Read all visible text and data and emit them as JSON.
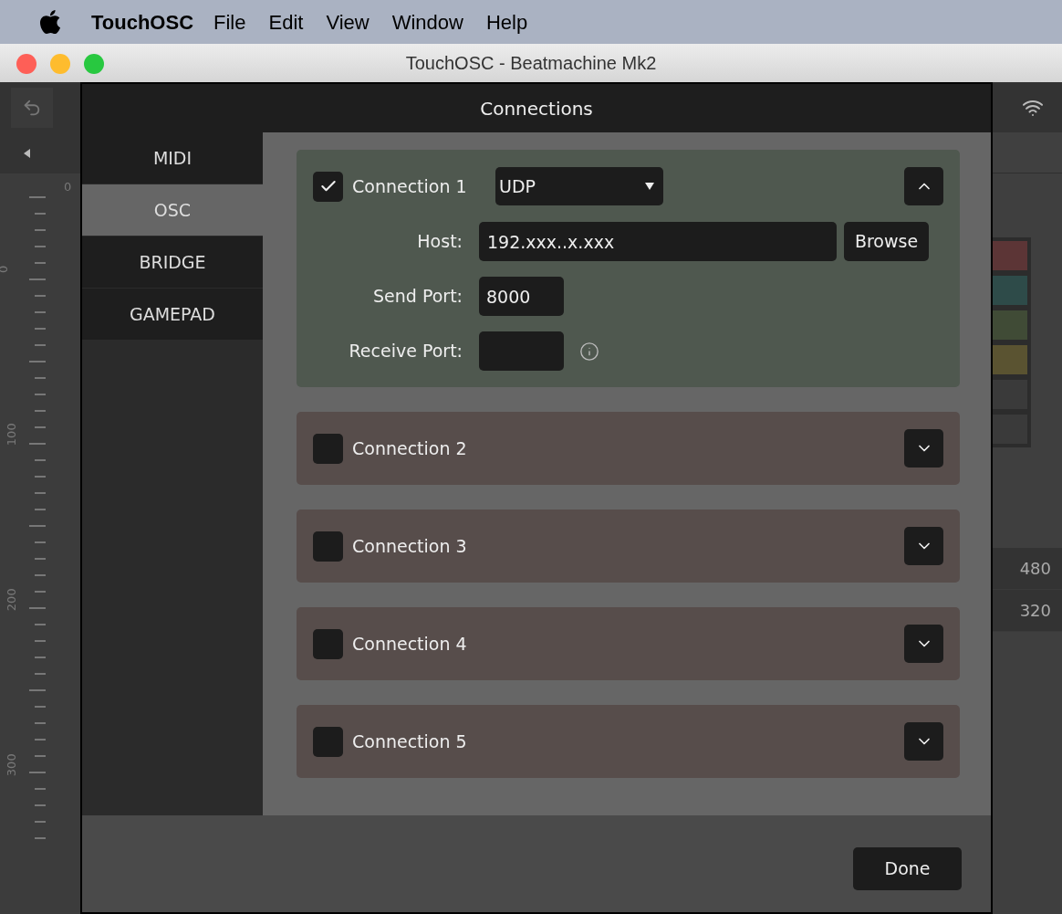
{
  "menu_bar": {
    "app": "TouchOSC",
    "items": [
      "File",
      "Edit",
      "View",
      "Window",
      "Help"
    ]
  },
  "window": {
    "title": "TouchOSC - Beatmachine Mk2"
  },
  "background": {
    "top_ruler_label": "0",
    "ruler_labels": [
      "0",
      "100",
      "200",
      "300"
    ],
    "swatches": [
      {
        "color": "#5c3536"
      },
      {
        "color": "#2e4b49"
      },
      {
        "color": "#404b36"
      },
      {
        "color": "#5a5331"
      },
      {
        "color": "#3a3a3a"
      },
      {
        "color": "#3a3a3a"
      }
    ],
    "right_values": [
      "480",
      "320"
    ]
  },
  "dialog": {
    "title": "Connections",
    "tabs": [
      {
        "label": "MIDI",
        "selected": false
      },
      {
        "label": "OSC",
        "selected": true
      },
      {
        "label": "BRIDGE",
        "selected": false
      },
      {
        "label": "GAMEPAD",
        "selected": false
      }
    ],
    "connections": [
      {
        "name": "Connection 1",
        "checked": true,
        "expanded": true,
        "protocol": "UDP",
        "host_label": "Host:",
        "host": "192.xxx..x.xxx",
        "browse": "Browse",
        "send_port_label": "Send Port:",
        "send_port": "8000",
        "receive_port_label": "Receive Port:"
      },
      {
        "name": "Connection 2",
        "checked": false,
        "expanded": false
      },
      {
        "name": "Connection 3",
        "checked": false,
        "expanded": false
      },
      {
        "name": "Connection 4",
        "checked": false,
        "expanded": false
      },
      {
        "name": "Connection 5",
        "checked": false,
        "expanded": false
      }
    ],
    "done": "Done"
  }
}
